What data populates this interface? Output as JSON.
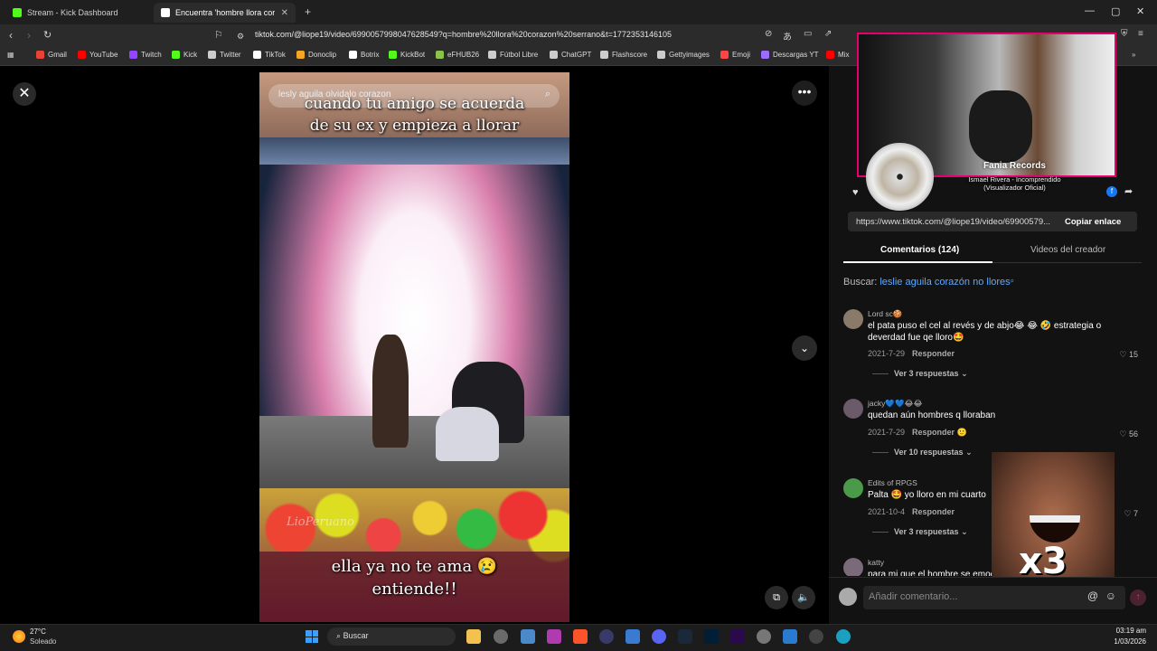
{
  "browser": {
    "tabs": [
      {
        "label": "Stream - Kick Dashboard",
        "favicon_color": "#53fc18"
      },
      {
        "label": "Encuentra 'hombre llora cora…",
        "favicon_color": "#ffffff"
      }
    ],
    "new_tab_label": "+",
    "url": "tiktok.com/@liope19/video/6990057998047628549?q=hombre%20llora%20corazon%20serrano&t=1772353146105",
    "bookmarks": [
      {
        "label": "Gmail",
        "color": "#ea4335"
      },
      {
        "label": "YouTube",
        "color": "#ff0000"
      },
      {
        "label": "Twitch",
        "color": "#9146ff"
      },
      {
        "label": "Kick",
        "color": "#53fc18"
      },
      {
        "label": "Twitter",
        "color": "#cccccc"
      },
      {
        "label": "TikTok",
        "color": "#ffffff"
      },
      {
        "label": "Donoclip",
        "color": "#f5a623"
      },
      {
        "label": "Botrix",
        "color": "#ffffff"
      },
      {
        "label": "KickBot",
        "color": "#53fc18"
      },
      {
        "label": "eFHUB26",
        "color": "#8bc34a"
      },
      {
        "label": "Fútbol Libre",
        "color": "#cccccc"
      },
      {
        "label": "ChatGPT",
        "color": "#cccccc"
      },
      {
        "label": "Flashscore",
        "color": "#cccccc"
      },
      {
        "label": "Gettyimages",
        "color": "#cccccc"
      },
      {
        "label": "Emoji",
        "color": "#ff4444"
      },
      {
        "label": "Descargas YT",
        "color": "#9c6bff"
      },
      {
        "label": "Mix",
        "color": "#ff0000"
      }
    ]
  },
  "video": {
    "search_text": "lesly aguila olvidalo corazon",
    "caption_top_line1": "cuando tu amigo se acuerda",
    "caption_top_line2": "de su ex y empieza a llorar",
    "caption_bottom_line1": "ella ya no te ama 😢",
    "caption_bottom_line2": "entiende!!",
    "watermark": "LioPeruano"
  },
  "overlay": {
    "np_title": "Fania Records",
    "np_subtitle_line1": "Ismael Rivera - Incomprendido",
    "np_subtitle_line2": "(Visualizador Oficial)",
    "meme_text": "x3"
  },
  "panel": {
    "share_url": "https://www.tiktok.com/@liope19/video/69900579...",
    "copy_label": "Copiar enlace",
    "tab_comments": "Comentarios (124)",
    "tab_creator": "Videos del creador",
    "search_prefix": "Buscar:",
    "search_query": "leslie aguila corazón no llores",
    "reply_label": "Responder",
    "comments": [
      {
        "user": "Lord sc🍪",
        "text": "el pata puso el cel al revés y de abjo😂 😂 🤣 estrategia o deverdad fue qe lloro🤩",
        "date": "2021-7-29",
        "likes": "15",
        "more": "Ver 3 respuestas",
        "avatar_color": "#8a7a6a"
      },
      {
        "user": "jacky💙💙😂😂",
        "text": "quedan aún hombres q lloraban",
        "date": "2021-7-29",
        "likes": "56",
        "more": "Ver 10 respuestas",
        "avatar_color": "#6a5a6a"
      },
      {
        "user": "Edits of RPGS",
        "text": "Palta 🤩 yo lloro en mi cuarto",
        "date": "2021-10-4",
        "likes": "7",
        "more": "Ver 3 respuestas",
        "avatar_color": "#4a9a4a"
      },
      {
        "user": "katty",
        "text": "para mi que el hombre se emocionó",
        "date": "",
        "likes": "",
        "more": "",
        "avatar_color": "#7a6a7a"
      }
    ],
    "comment_placeholder": "Añadir comentario..."
  },
  "taskbar": {
    "temp": "27°C",
    "weather": "Soleado",
    "search": "Buscar",
    "time": "03:19 am",
    "date": "1/03/2026"
  }
}
